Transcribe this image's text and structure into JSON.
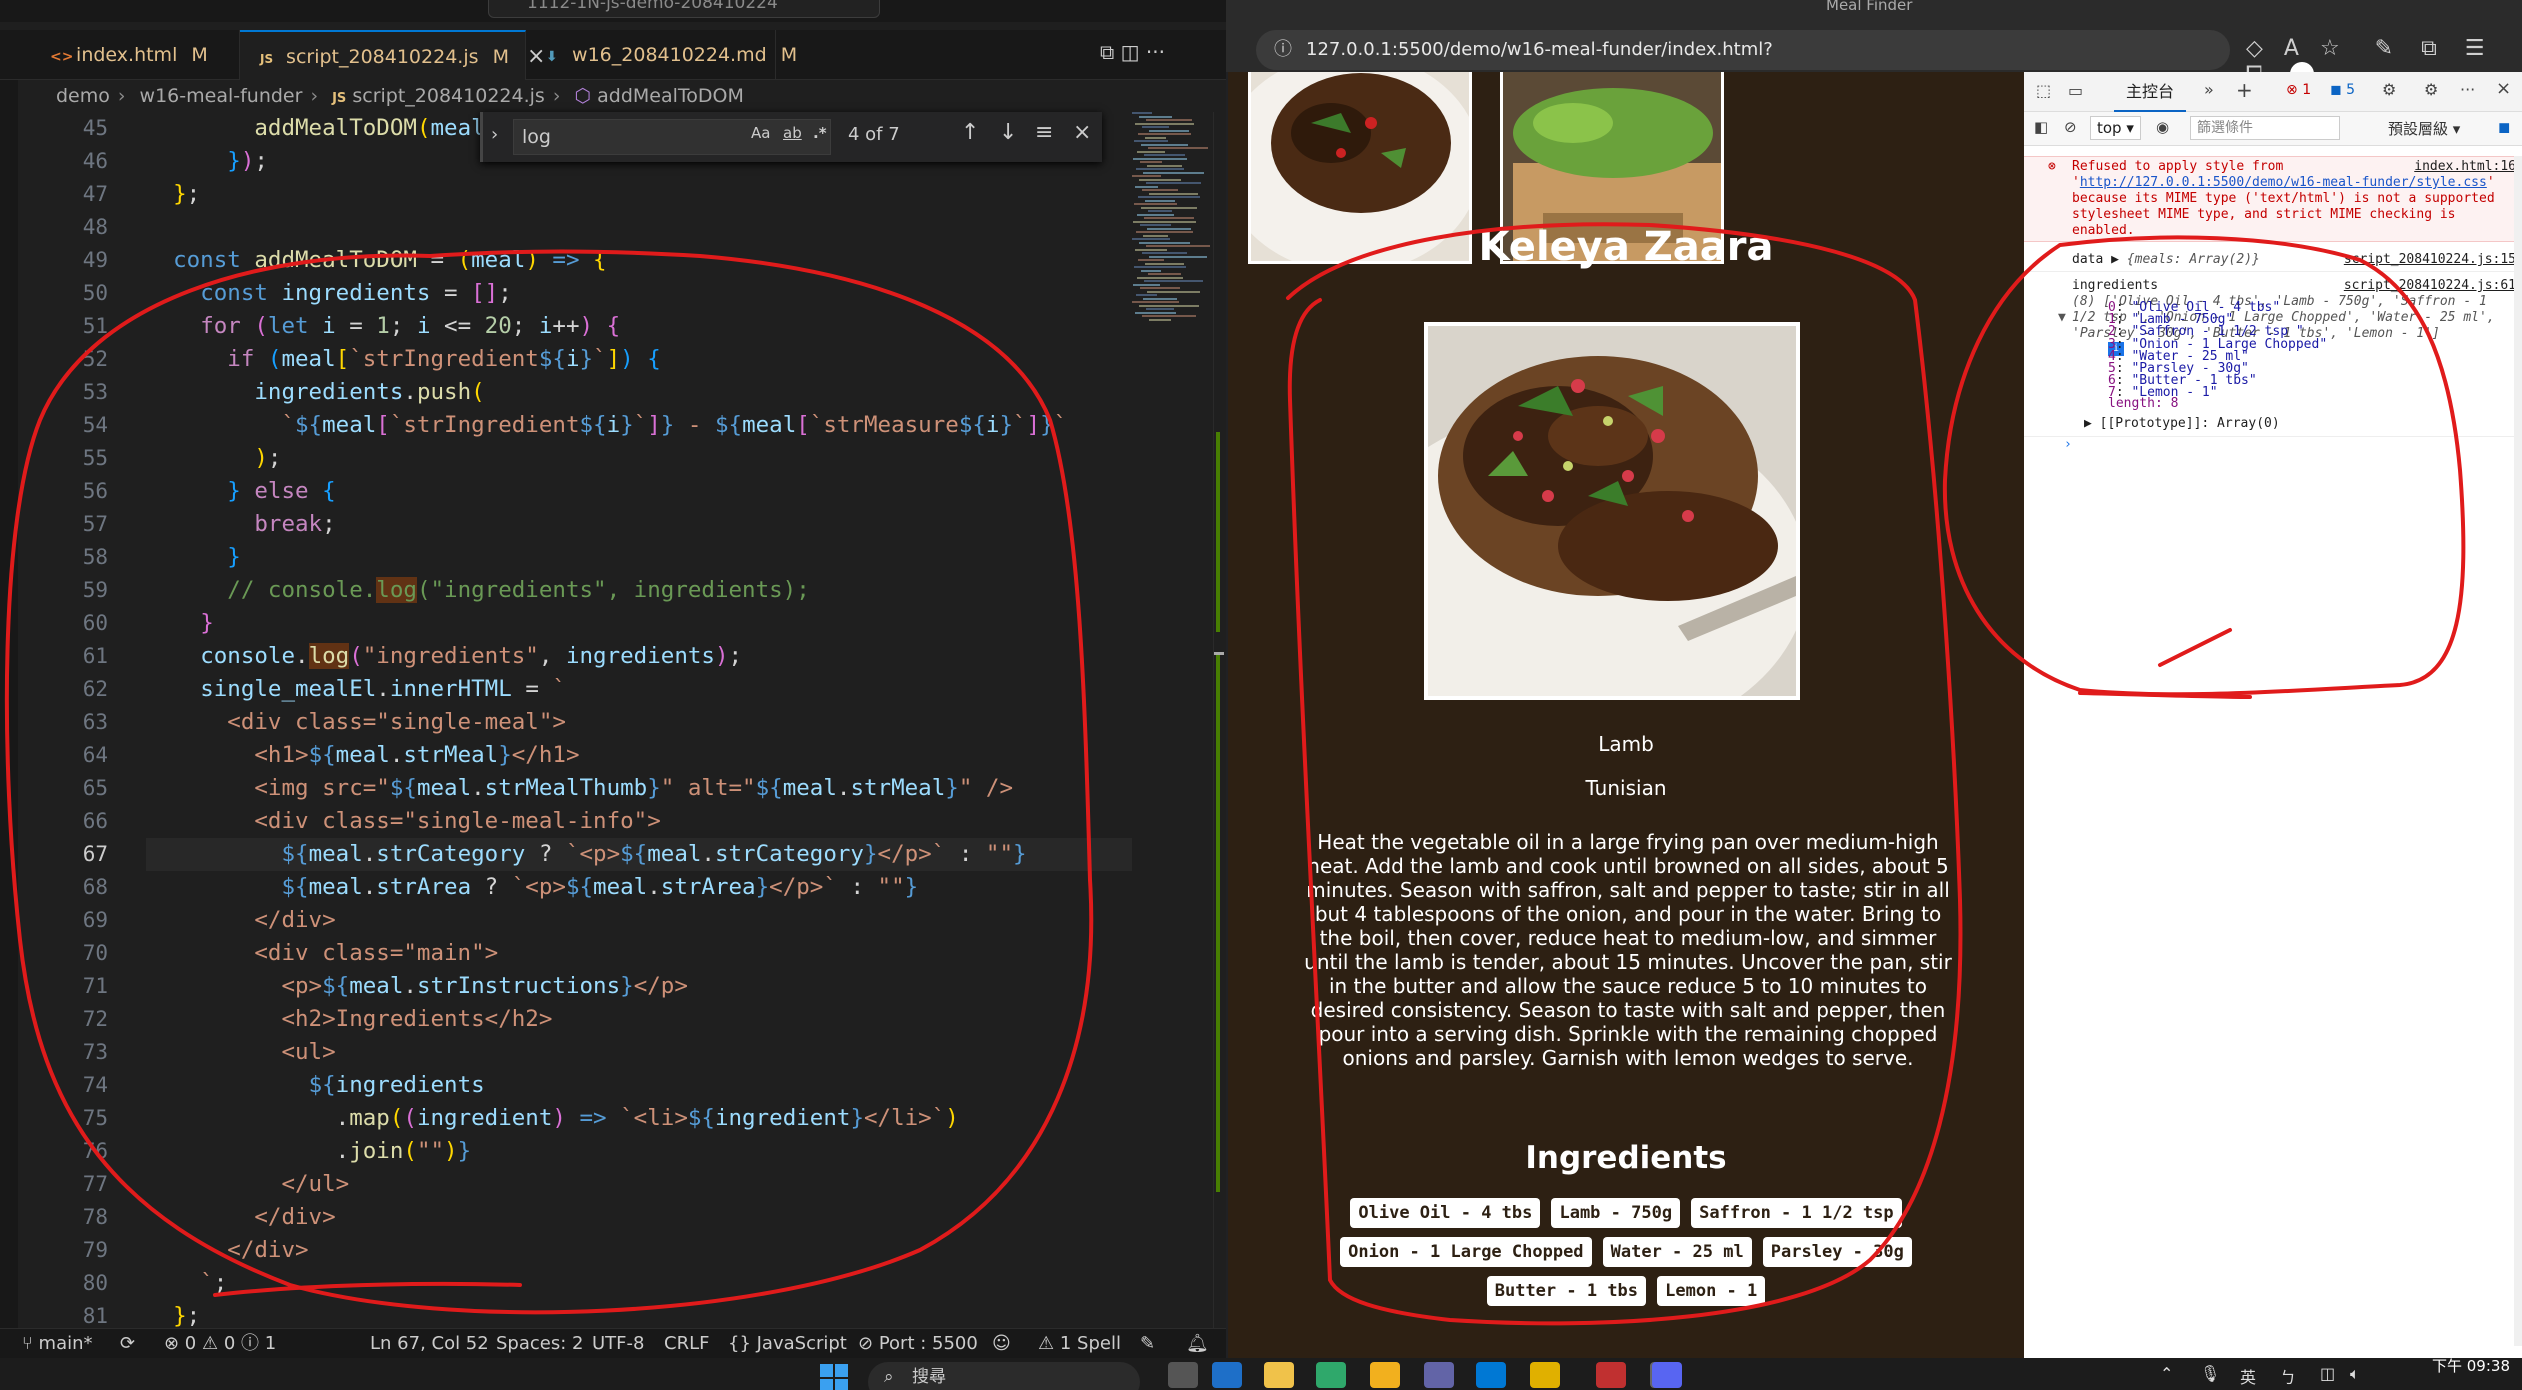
{
  "vscode": {
    "command_center": "1112-1N-js-demo-208410224",
    "tabs": [
      {
        "icon": "<>",
        "label": "index.html",
        "modified": "M"
      },
      {
        "icon": "JS",
        "label": "script_208410224.js",
        "modified": "M"
      },
      {
        "icon": "⬇",
        "label": "w16_208410224.md",
        "modified": "M"
      }
    ],
    "breadcrumb": [
      "demo",
      "w16-meal-funder",
      "script_208410224.js",
      "addMealToDOM"
    ],
    "find": {
      "query": "log",
      "count": "4 of 7",
      "case_label": "Aa",
      "word_label": "ab",
      "regex_label": ".*"
    },
    "line_numbers": [
      "45",
      "46",
      "47",
      "48",
      "49",
      "50",
      "51",
      "52",
      "53",
      "54",
      "55",
      "56",
      "57",
      "58",
      "59",
      "60",
      "61",
      "62",
      "63",
      "64",
      "65",
      "66",
      "67",
      "68",
      "69",
      "70",
      "71",
      "72",
      "73",
      "74",
      "75",
      "76",
      "77",
      "78",
      "79",
      "80",
      "81"
    ],
    "current_line": "67",
    "status": {
      "branch": "main*",
      "problems": "⊗ 0 ⚠ 0 ⓘ 1",
      "position": "Ln 67, Col 52",
      "spaces": "Spaces: 2",
      "encoding": "UTF-8",
      "eol": "CRLF",
      "language": "{} JavaScript",
      "port": "Port : 5500",
      "spell": "⚠ 1 Spell"
    }
  },
  "browser": {
    "window_title": "Meal Finder",
    "url": "127.0.0.1:5500/demo/w16-meal-funder/index.html?",
    "meal": {
      "title": "Keleya Zaara",
      "category": "Lamb",
      "area": "Tunisian",
      "instructions": "Heat the vegetable oil in a large frying pan over medium-high heat. Add the lamb and cook until browned on all sides, about 5 minutes. Season with saffron, salt and pepper to taste; stir in all but 4 tablespoons of the onion, and pour in the water. Bring to the boil, then cover, reduce heat to medium-low, and simmer until the lamb is tender, about 15 minutes. Uncover the pan, stir in the butter and allow the sauce reduce 5 to 10 minutes to desired consistency. Season to taste with salt and pepper, then pour into a serving dish. Sprinkle with the remaining chopped onions and parsley. Garnish with lemon wedges to serve.",
      "ingredients_heading": "Ingredients",
      "ingredients": [
        "Olive Oil - 4 tbs",
        "Lamb - 750g",
        "Saffron - 1 1/2 tsp",
        "Onion - 1 Large Chopped",
        "Water - 25 ml",
        "Parsley - 30g",
        "Butter - 1 tbs",
        "Lemon - 1"
      ]
    },
    "devtools": {
      "console_tab": "主控台",
      "error_count": "1",
      "info_count": "5",
      "context": "top",
      "filter_placeholder": "篩選條件",
      "levels": "預設層級",
      "error_text_1": "Refused to apply style from '",
      "error_link": "http://127.0.0.1:5500/demo/w16-meal-funder/style.css",
      "error_text_2": "' because its MIME type ('text/html') is not a supported stylesheet MIME type, and strict MIME checking is enabled.",
      "error_src": "index.html:16",
      "data_label": "data",
      "data_value": "{meals: Array(2)}",
      "data_src": "script_208410224.js:15",
      "ing_label": "ingredients",
      "ing_src": "script_208410224.js:61",
      "ing_preview": "(8) ['Olive Oil - 4 tbs', 'Lamb - 750g', 'Saffron - 1 1/2 tsp ', 'Onion - 1 Large Chopped', 'Water - 25 ml', 'Parsley - 30g', 'Butter - 1 tbs', 'Lemon - 1']",
      "entries": [
        {
          "k": "0",
          "v": "\"Olive Oil - 4 tbs\""
        },
        {
          "k": "1",
          "v": "\"Lamb - 750g\""
        },
        {
          "k": "2",
          "v": "\"Saffron - 1 1/2 tsp \""
        },
        {
          "k": "3",
          "v": "\"Onion - 1 Large Chopped\""
        },
        {
          "k": "4",
          "v": "\"Water - 25 ml\""
        },
        {
          "k": "5",
          "v": "\"Parsley - 30g\""
        },
        {
          "k": "6",
          "v": "\"Butter - 1 tbs\""
        },
        {
          "k": "7",
          "v": "\"Lemon - 1\""
        }
      ],
      "length": "length: 8",
      "prototype": "[[Prototype]]: Array(0)"
    }
  },
  "taskbar": {
    "search": "搜尋",
    "lang": "英",
    "time": "下午 09:38"
  },
  "colors": {
    "annotation": "#e01b1b",
    "page_bg": "#2d2013",
    "accent": "#0078d4"
  }
}
